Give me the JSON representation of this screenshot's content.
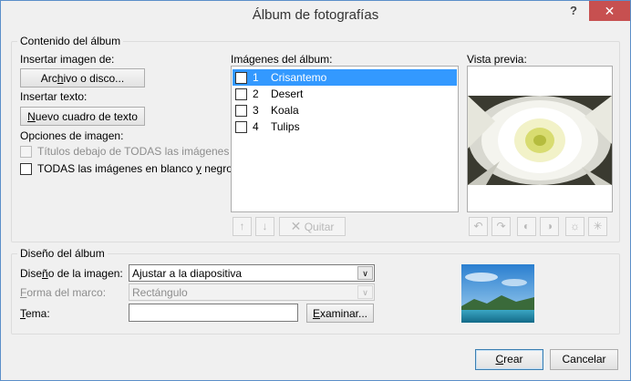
{
  "window": {
    "title": "Álbum de fotografías",
    "help_label": "?",
    "close_label": "✕"
  },
  "contenido": {
    "legend": "Contenido del álbum",
    "insert_image_label": "Insertar imagen de:",
    "file_button": {
      "pre": "Arc",
      "acc": "h",
      "post": "ivo o disco..."
    },
    "insert_text_label": "Insertar texto:",
    "text_box_button": {
      "pre": "",
      "acc": "N",
      "post": "uevo cuadro de texto"
    },
    "image_options_label": "Opciones de imagen:",
    "captions_option": "Títulos debajo de TODAS las imágenes",
    "bw_option": {
      "pre": "TODAS las imágenes en blanco ",
      "acc": "y",
      "post": " negro"
    },
    "album_images_label": "Imágenes del álbum:",
    "images": [
      {
        "num": "1",
        "name": "Crisantemo"
      },
      {
        "num": "2",
        "name": "Desert"
      },
      {
        "num": "3",
        "name": "Koala"
      },
      {
        "num": "4",
        "name": "Tulips"
      }
    ],
    "remove_button": "Quitar",
    "preview_label": "Vista previa:"
  },
  "diseno": {
    "legend": "Diseño del álbum",
    "layout_label": {
      "pre": "Dise",
      "acc": "ñ",
      "post": "o de la imagen:"
    },
    "layout_value": "Ajustar a la diapositiva",
    "frame_label": {
      "pre": "",
      "acc": "F",
      "post": "orma del marco:"
    },
    "frame_value": "Rectángulo",
    "theme_label": {
      "pre": "",
      "acc": "T",
      "post": "ema:"
    },
    "theme_value": "",
    "browse_button": {
      "pre": "",
      "acc": "E",
      "post": "xaminar..."
    }
  },
  "footer": {
    "create_button": {
      "pre": "",
      "acc": "C",
      "post": "rear"
    },
    "cancel_button": "Cancelar"
  }
}
